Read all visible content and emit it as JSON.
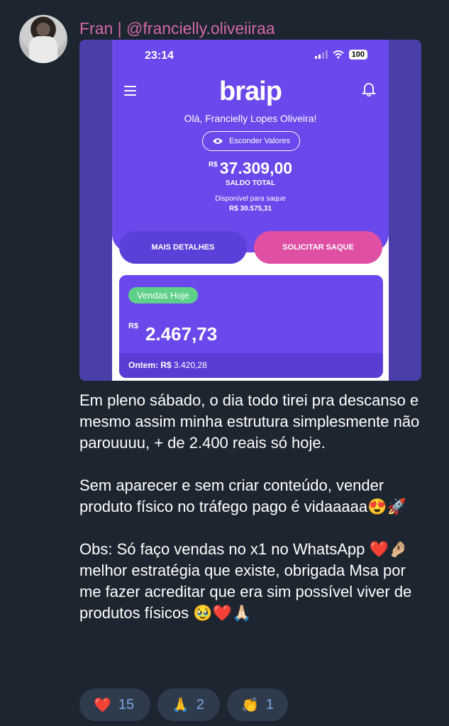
{
  "message": {
    "sender": "Fran | @francielly.oliveiiraa",
    "text": "Em pleno sábado, o dia todo tirei pra descanso e mesmo assim minha estrutura simplesmente não parouuuu, + de 2.400 reais só hoje.\n\nSem aparecer e sem criar conteúdo, vender produto físico no tráfego pago é vidaaaaa😍🚀\n\nObs: Só faço vendas no x1 no WhatsApp ❤️🤌🏼 melhor estratégia que existe, obrigada Msa por me fazer acreditar que era sim possível viver de produtos físicos 🥹❤️🙏🏻"
  },
  "screenshot": {
    "status_time": "23:14",
    "battery": "100",
    "logo": "braip",
    "greeting": "Olá, Francielly Lopes Oliveira!",
    "hide_values_label": "Esconder Valores",
    "currency": "R$",
    "balance_value": "37.309,00",
    "balance_label": "SALDO TOTAL",
    "available_label": "Disponível para saque",
    "available_value": "R$ 30.575,31",
    "details_button": "MAIS DETALHES",
    "withdraw_button": "SOLICITAR SAQUE",
    "sales_badge": "Vendas Hoje",
    "sales_value": "2.467,73",
    "yesterday_label": "Ontem: R$",
    "yesterday_value": "3.420,28"
  },
  "reactions": [
    {
      "emoji": "❤️",
      "count": "15"
    },
    {
      "emoji": "🙏",
      "count": "2"
    },
    {
      "emoji": "👏",
      "count": "1"
    }
  ],
  "colors": {
    "background": "#1c2530",
    "sender": "#d36aa2",
    "app_purple": "#6a48ec",
    "app_pink": "#df4fa4",
    "badge_green": "#5ed08a",
    "reaction_bg": "#2e3b4c"
  }
}
